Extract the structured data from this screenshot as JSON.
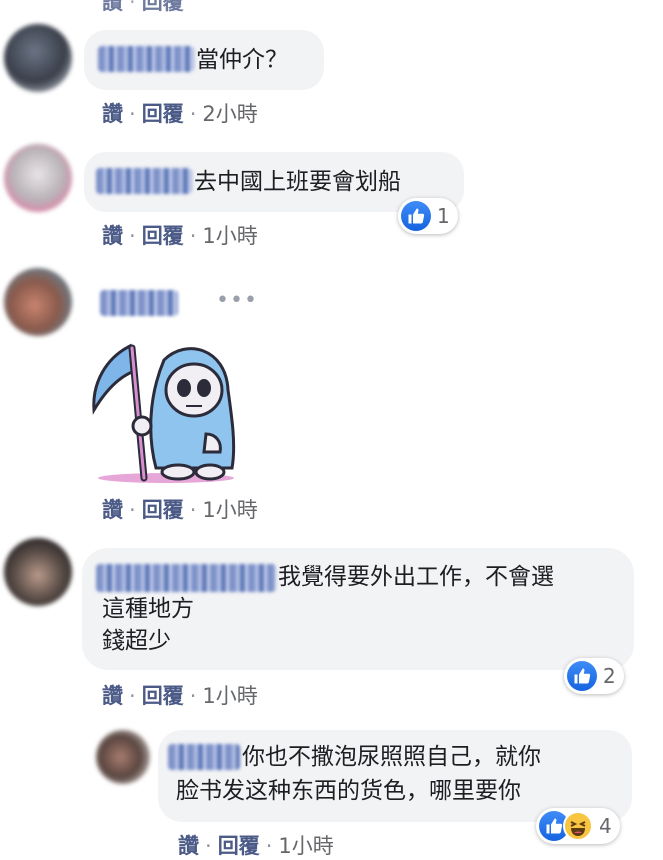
{
  "comments": [
    {
      "text": "當仲介？",
      "actions": {
        "like": "讚",
        "reply": "回覆",
        "sep": "·",
        "time": "2小時"
      }
    },
    {
      "text": "去中國上班要會划船",
      "actions": {
        "like": "讚",
        "reply": "回覆",
        "sep": "·",
        "time": "1小時"
      },
      "reaction_count": "1"
    },
    {
      "sticker": "grim-reaper-sticker",
      "actions": {
        "like": "讚",
        "reply": "回覆",
        "sep": "·",
        "time": "1小時"
      }
    },
    {
      "lines": [
        "我覺得要外出工作，不會選",
        "這種地方",
        "錢超少"
      ],
      "actions": {
        "like": "讚",
        "reply": "回覆",
        "sep": "·",
        "time": "1小時"
      },
      "reaction_count": "2"
    },
    {
      "lines": [
        "你也不撒泡尿照照自己，就你",
        "脸书发这种东西的货色，哪里要你"
      ],
      "actions": {
        "like": "讚",
        "reply": "回覆",
        "sep": "·",
        "time": "1小時"
      },
      "reaction_count": "4"
    }
  ],
  "icons": {
    "like": "thumbs-up-icon",
    "haha": "laughing-face-icon",
    "more": "more-options-icon"
  },
  "colors": {
    "bubble": "#f2f3f5",
    "link": "#4b5a87",
    "like_blue": "#1877f2"
  }
}
